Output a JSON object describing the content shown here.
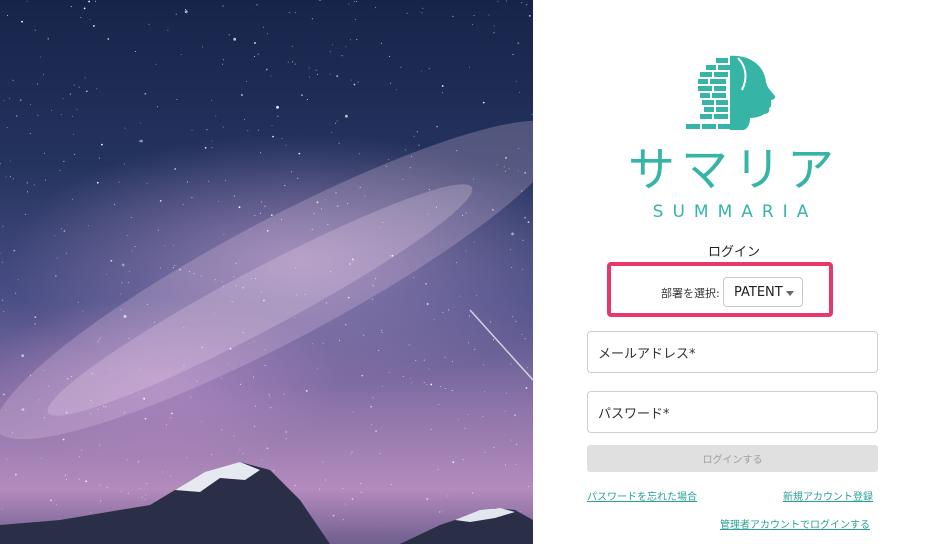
{
  "brand": {
    "name_jp": "サマリア",
    "name_en": "SUMMARIA",
    "accent_color": "#36b4a6",
    "logo_icon": "head-profile-icon"
  },
  "login": {
    "title": "ログイン",
    "department": {
      "label": "部署を選択:",
      "selected": "PATENT",
      "highlight_color": "#e8386b"
    },
    "email": {
      "label": "メールアドレス*"
    },
    "password": {
      "label": "パスワード*"
    },
    "submit_label": "ログインする",
    "links": {
      "forgot_password": "パスワードを忘れた場合",
      "signup": "新規アカウント登録",
      "admin_login": "管理者アカウントでログインする"
    }
  },
  "hero": {
    "image": "starry-sky-mountain"
  }
}
